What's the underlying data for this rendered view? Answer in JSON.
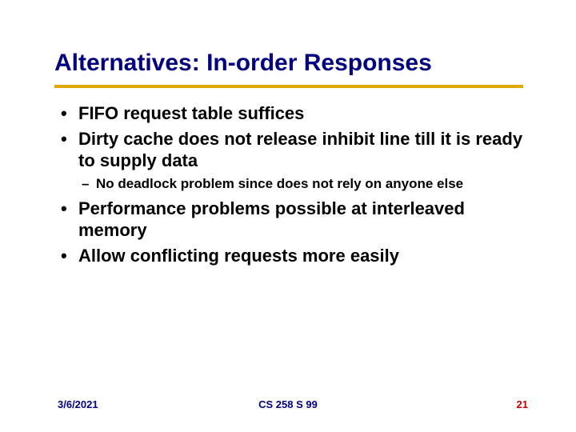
{
  "title": "Alternatives: In-order Responses",
  "bullets": {
    "b1": "FIFO request table suffices",
    "b2": "Dirty cache does not release inhibit line till it is ready to supply data",
    "b2_sub1": "No deadlock problem since does not rely on anyone else",
    "b3": "Performance problems possible at interleaved memory",
    "b4": "Allow conflicting requests more easily"
  },
  "footer": {
    "date": "3/6/2021",
    "center": "CS 258 S 99",
    "page": "21"
  }
}
